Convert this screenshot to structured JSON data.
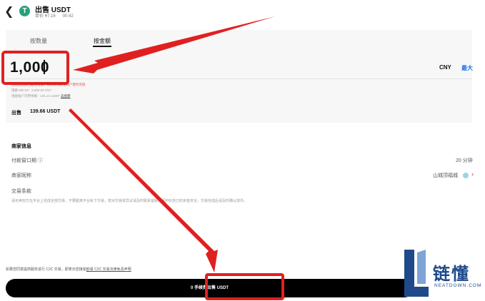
{
  "header": {
    "back_icon": "chevron-left-icon",
    "coin_glyph": "T",
    "title": "出售 USDT",
    "price": "单价 ¥7.16",
    "timer": "00:42"
  },
  "tabs": [
    {
      "label": "按数量",
      "active": false
    },
    {
      "label": "按金额",
      "active": true
    }
  ],
  "amount": {
    "value": "1,000",
    "currency": "CNY",
    "max_label": "最大"
  },
  "hints": {
    "line1": "可出售金额已超过限额，请修改或联系商户暂时充值",
    "line2": "限额 900.00 - 3,000.00 CNY",
    "line3": "现金账户可用余额：191.21 USDT",
    "line3_link": "去划转"
  },
  "sell": {
    "label": "出售",
    "value": "139.66 USDT"
  },
  "merchant": {
    "section_title": "商家信息",
    "payment_window_label": "付款窗口期 ⓘ",
    "payment_window_value": "20 分钟",
    "nickname_label": "商家昵称",
    "nickname_value": "山城顶福城",
    "terms_label": "交易条款",
    "terms_text": "请买卖双方在平台上完成全部交易，不要脱离平台私下交易，若对交易有异议请及时联系客服，保护好自己的资金安全，交易完成后请及时确认放币。"
  },
  "footer": {
    "note_prefix": "如果您同意提供服务进行 C2C 交易，即表示您接受",
    "note_link": "欧易 C2C 交易法律免责声明",
    "button_label": "0 手续费出售 USDT"
  },
  "watermark": {
    "cn": "链懂",
    "en": "NEATDOWN.COM"
  },
  "colors": {
    "accent": "#1a73e8",
    "annotation": "#e02020",
    "button_bg": "#000000",
    "coin": "#26a17b",
    "watermark": "#1e4a8a"
  }
}
